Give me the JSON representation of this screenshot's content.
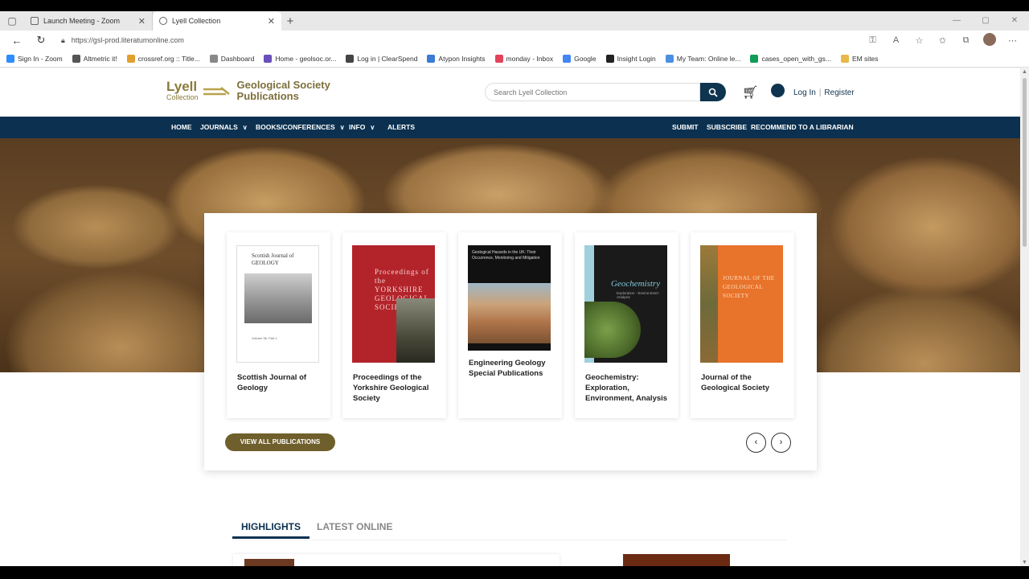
{
  "browser": {
    "tabs": [
      {
        "title": "Launch Meeting - Zoom",
        "close": "✕"
      },
      {
        "title": "Lyell Collection",
        "close": "✕"
      }
    ],
    "new_tab": "+",
    "url": "https://gsl-prod.literatumonline.com",
    "bookmarks": [
      {
        "label": "Sign In - Zoom",
        "color": "#2d8cff"
      },
      {
        "label": "Altmetric it!",
        "color": "#555555"
      },
      {
        "label": "crossref.org :: Title...",
        "color": "#e0a030"
      },
      {
        "label": "Dashboard",
        "color": "#888888"
      },
      {
        "label": "Home - geolsoc.or...",
        "color": "#6b4fbb"
      },
      {
        "label": "Log in | ClearSpend",
        "color": "#444444"
      },
      {
        "label": "Atypon Insights",
        "color": "#3a7bd5"
      },
      {
        "label": "monday - Inbox",
        "color": "#e2445c"
      },
      {
        "label": "Google",
        "color": "#4285f4"
      },
      {
        "label": "Insight Login",
        "color": "#222222"
      },
      {
        "label": "My Team: Online le...",
        "color": "#4a90e2"
      },
      {
        "label": "cases_open_with_gs...",
        "color": "#0f9d58"
      },
      {
        "label": "EM sites",
        "color": "#e8b84a"
      }
    ]
  },
  "header": {
    "logo_lyell": "Lyell",
    "logo_collection": "Collection",
    "logo_gs_line1": "Geological Society",
    "logo_gs_line2": "Publications",
    "search_placeholder": "Search Lyell Collection",
    "login": "Log In",
    "separator": "|",
    "register": "Register"
  },
  "nav": {
    "home": "HOME",
    "journals": "JOURNALS",
    "books": "BOOKS/CONFERENCES",
    "info": "INFO",
    "alerts": "ALERTS",
    "submit": "SUBMIT",
    "subscribe": "SUBSCRIBE",
    "recommend": "RECOMMEND TO A LIBRARIAN"
  },
  "publications": [
    {
      "title": "Scottish Journal of Geology",
      "cover_title": "Scottish Journal of GEOLOGY",
      "cover_volume": "Volume 56, Part 1"
    },
    {
      "title": "Proceedings of the Yorkshire Geological Society",
      "cover_title": "Proceedings of the YORKSHIRE GEOLOGICAL SOCIETY"
    },
    {
      "title": "Engineering Geology Special Publications",
      "cover_title": "Geological Hazards in the UK: Their Occurrence, Monitoring and Mitigation"
    },
    {
      "title": "Geochemistry: Exploration, Environment, Analysis",
      "cover_title": "Geochemistry",
      "cover_sub": "Exploration · Environment · Analysis"
    },
    {
      "title": "Journal of the Geological Society",
      "cover_title": "JOURNAL OF THE GEOLOGICAL SOCIETY"
    }
  ],
  "view_all": "VIEW ALL PUBLICATIONS",
  "carousel": {
    "prev": "‹",
    "next": "›"
  },
  "content_tabs": {
    "highlights": "HIGHLIGHTS",
    "latest": "LATEST ONLINE"
  }
}
